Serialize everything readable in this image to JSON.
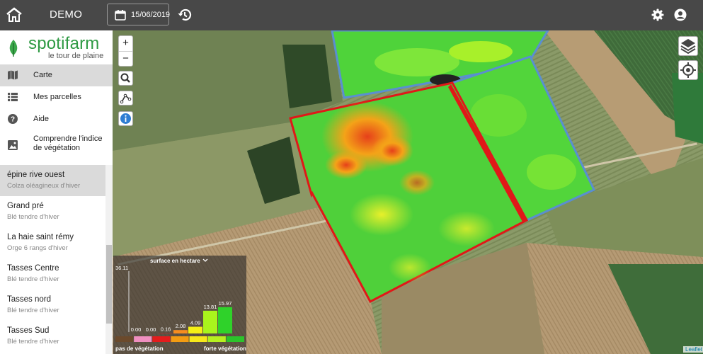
{
  "header": {
    "title": "DEMO",
    "date": "15/06/2019",
    "icons": [
      "home-icon",
      "calendar-icon",
      "history-icon",
      "gear-icon",
      "account-icon"
    ]
  },
  "logo": {
    "brand": "spotifarm",
    "tagline": "le tour de plaine"
  },
  "nav": [
    {
      "label": "Carte",
      "icon": "map-icon"
    },
    {
      "label": "Mes parcelles",
      "icon": "list-icon"
    },
    {
      "label": "Aide",
      "icon": "help-icon"
    },
    {
      "label": "Comprendre l'indice de végétation",
      "icon": "image-icon"
    }
  ],
  "parcels": [
    {
      "name": "épine rive ouest",
      "crop": "Colza oléagineux d'hiver"
    },
    {
      "name": "Grand pré",
      "crop": "Blé tendre d'hiver"
    },
    {
      "name": "La haie saint rémy",
      "crop": "Orge 6 rangs d'hiver"
    },
    {
      "name": "Tasses Centre",
      "crop": "Blé tendre d'hiver"
    },
    {
      "name": "Tasses nord",
      "crop": "Blé tendre d'hiver"
    },
    {
      "name": "Tasses Sud",
      "crop": "Blé tendre d'hiver"
    }
  ],
  "map": {
    "zoom_in": "+",
    "zoom_out": "−",
    "tools": [
      "search-icon",
      "measure-icon",
      "info-icon"
    ],
    "attribution": "Leaflet"
  },
  "legend": {
    "header": "surface en hectare",
    "ymax": "36.11",
    "left_label": "pas de végétation",
    "right_label": "forte végétation"
  },
  "chart_data": {
    "type": "bar",
    "title": "surface en hectare",
    "ylim": [
      0,
      36.11
    ],
    "values": [
      0.0,
      0.0,
      0.16,
      2.08,
      4.09,
      13.81,
      15.97
    ],
    "value_labels": [
      "0.00",
      "0.00",
      "0.16",
      "2.08",
      "4.09",
      "13.81",
      "15.97"
    ],
    "colors": [
      "#d46e9a",
      "#ee1c1c",
      "#f78d1f",
      "#f5f115",
      "#a9f51c",
      "#2fd22a"
    ],
    "scale_colors": [
      "#6b4a2c",
      "#f08fc0",
      "#e41c1c",
      "#f39c12",
      "#f7e81a",
      "#b6f01f",
      "#2bc42b"
    ]
  }
}
